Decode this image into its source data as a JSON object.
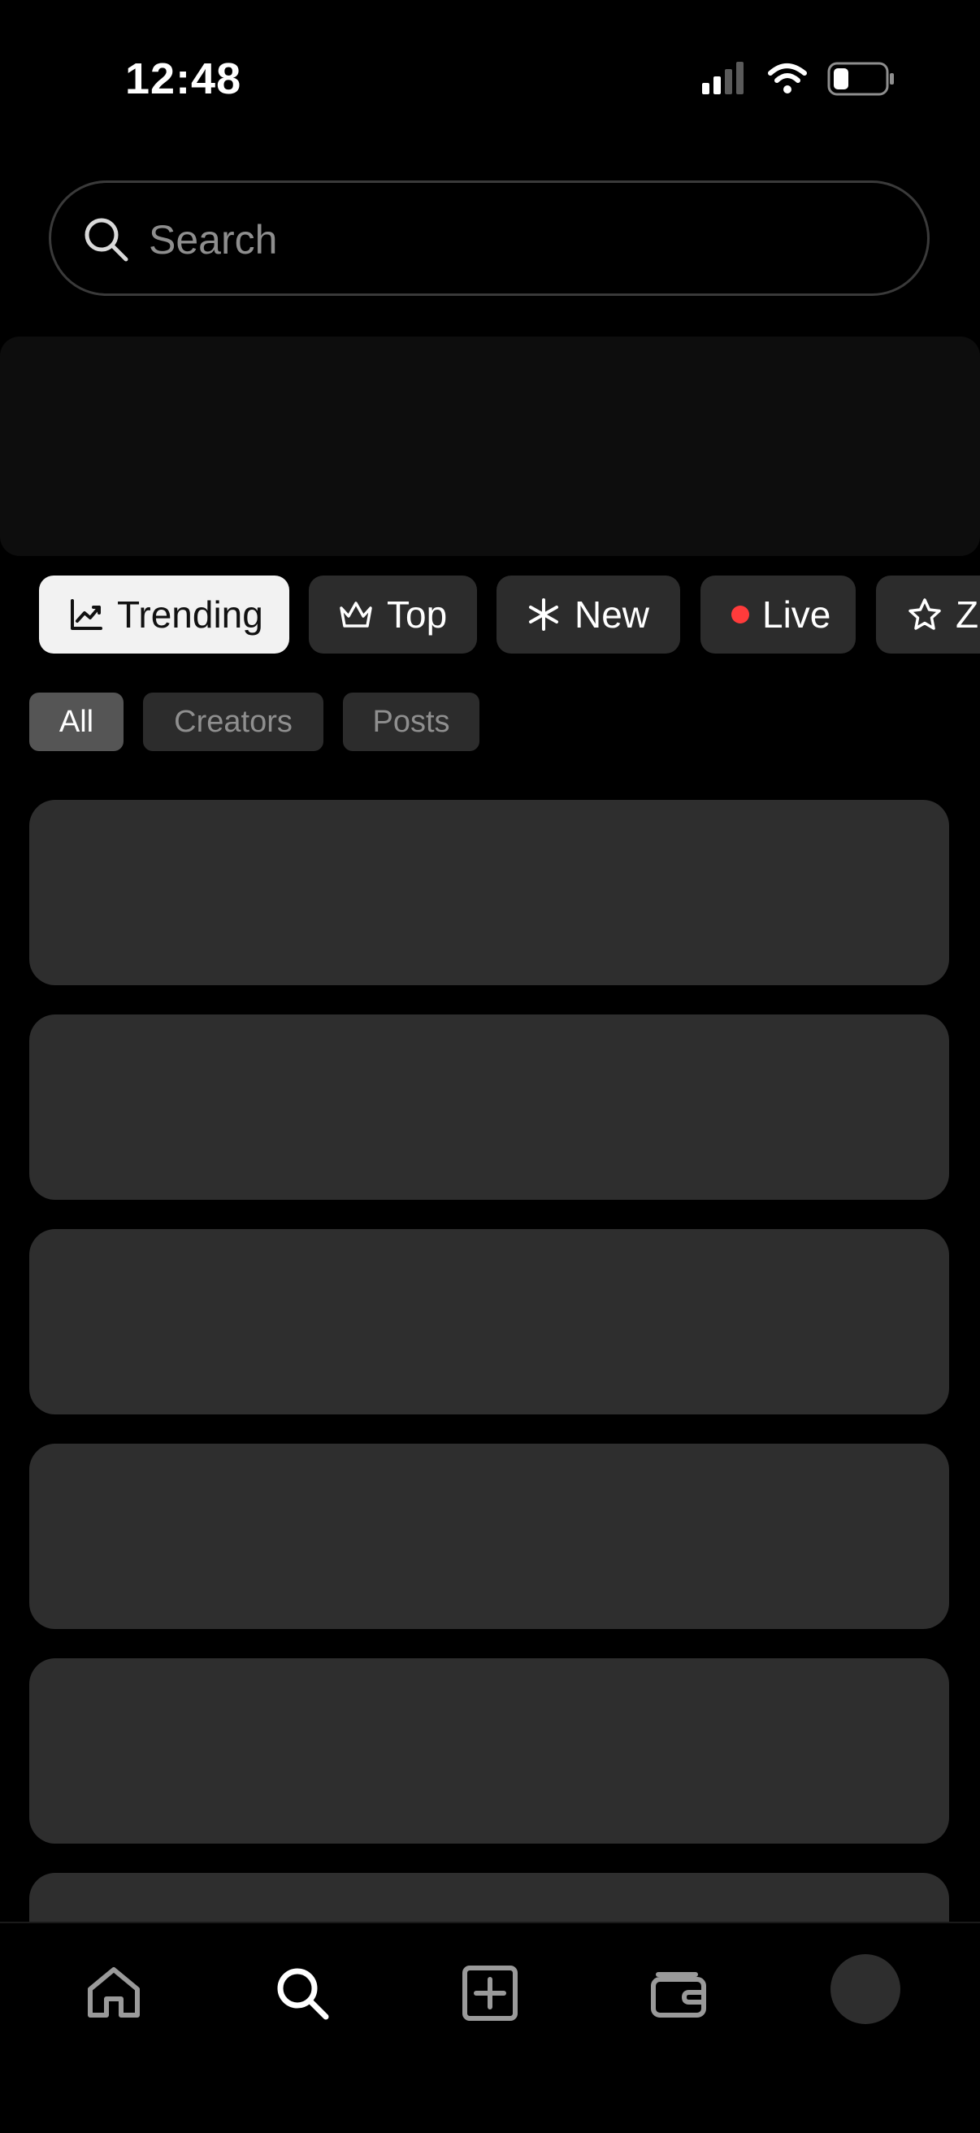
{
  "status_bar": {
    "time": "12:48",
    "icons": [
      "cellular-signal-icon",
      "wifi-icon",
      "battery-icon"
    ]
  },
  "search": {
    "placeholder": "Search",
    "value": ""
  },
  "category_chips": [
    {
      "label": "Trending",
      "icon": "trending-chart-icon",
      "active": true
    },
    {
      "label": "Top",
      "icon": "crown-icon",
      "active": false
    },
    {
      "label": "New",
      "icon": "asterisk-icon",
      "active": false
    },
    {
      "label": "Live",
      "icon": "live-dot",
      "active": false
    },
    {
      "label": "Zo",
      "icon": "star-icon",
      "active": false
    }
  ],
  "filters": [
    {
      "label": "All",
      "active": true
    },
    {
      "label": "Creators",
      "active": false
    },
    {
      "label": "Posts",
      "active": false
    }
  ],
  "tab_bar": {
    "items": [
      "home-icon",
      "search-icon",
      "create-icon",
      "wallet-icon",
      "profile-avatar"
    ],
    "active": "search-icon"
  },
  "colors": {
    "background": "#000000",
    "surface": "#2e2e2e",
    "chip_active_bg": "#f2f2f2",
    "live_dot": "#ff3b3b",
    "muted_text": "#8f8f8f"
  }
}
